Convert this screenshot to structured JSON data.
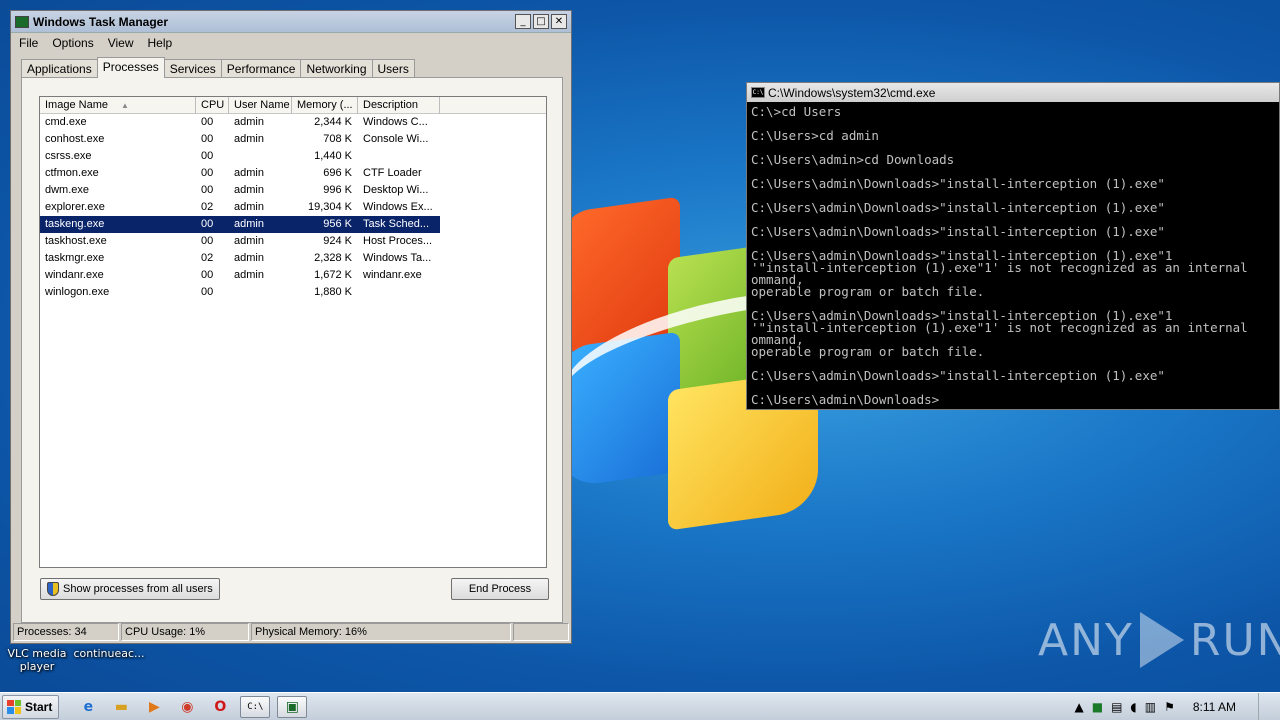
{
  "taskmgr": {
    "title": "Windows Task Manager",
    "menu": [
      "File",
      "Options",
      "View",
      "Help"
    ],
    "tabs": [
      "Applications",
      "Processes",
      "Services",
      "Performance",
      "Networking",
      "Users"
    ],
    "active_tab": "Processes",
    "columns": [
      "Image Name",
      "CPU",
      "User Name",
      "Memory (...",
      "Description"
    ],
    "sort_indicator": "▲",
    "processes": [
      {
        "name": "cmd.exe",
        "cpu": "00",
        "user": "admin",
        "mem": "2,344 K",
        "desc": "Windows C..."
      },
      {
        "name": "conhost.exe",
        "cpu": "00",
        "user": "admin",
        "mem": "708 K",
        "desc": "Console Wi..."
      },
      {
        "name": "csrss.exe",
        "cpu": "00",
        "user": "",
        "mem": "1,440 K",
        "desc": ""
      },
      {
        "name": "ctfmon.exe",
        "cpu": "00",
        "user": "admin",
        "mem": "696 K",
        "desc": "CTF Loader"
      },
      {
        "name": "dwm.exe",
        "cpu": "00",
        "user": "admin",
        "mem": "996 K",
        "desc": "Desktop Wi..."
      },
      {
        "name": "explorer.exe",
        "cpu": "02",
        "user": "admin",
        "mem": "19,304 K",
        "desc": "Windows Ex..."
      },
      {
        "name": "taskeng.exe",
        "cpu": "00",
        "user": "admin",
        "mem": "956 K",
        "desc": "Task Sched...",
        "selected": true
      },
      {
        "name": "taskhost.exe",
        "cpu": "00",
        "user": "admin",
        "mem": "924 K",
        "desc": "Host Proces..."
      },
      {
        "name": "taskmgr.exe",
        "cpu": "02",
        "user": "admin",
        "mem": "2,328 K",
        "desc": "Windows Ta..."
      },
      {
        "name": "windanr.exe",
        "cpu": "00",
        "user": "admin",
        "mem": "1,672 K",
        "desc": "windanr.exe"
      },
      {
        "name": "winlogon.exe",
        "cpu": "00",
        "user": "",
        "mem": "1,880 K",
        "desc": ""
      }
    ],
    "show_all_label": "Show processes from all users",
    "end_process_label": "End Process",
    "status": {
      "processes": "Processes: 34",
      "cpu": "CPU Usage: 1%",
      "memory": "Physical Memory: 16%"
    }
  },
  "cmd": {
    "title": "C:\\Windows\\system32\\cmd.exe",
    "lines": [
      "C:\\>cd Users",
      "",
      "C:\\Users>cd admin",
      "",
      "C:\\Users\\admin>cd Downloads",
      "",
      "C:\\Users\\admin\\Downloads>\"install-interception (1).exe\"",
      "",
      "C:\\Users\\admin\\Downloads>\"install-interception (1).exe\"",
      "",
      "C:\\Users\\admin\\Downloads>\"install-interception (1).exe\"",
      "",
      "C:\\Users\\admin\\Downloads>\"install-interception (1).exe\"1",
      "'\"install-interception (1).exe\"1' is not recognized as an internal",
      "ommand,",
      "operable program or batch file.",
      "",
      "C:\\Users\\admin\\Downloads>\"install-interception (1).exe\"1",
      "'\"install-interception (1).exe\"1' is not recognized as an internal",
      "ommand,",
      "operable program or batch file.",
      "",
      "C:\\Users\\admin\\Downloads>\"install-interception (1).exe\"",
      "",
      "C:\\Users\\admin\\Downloads>"
    ]
  },
  "desktop": {
    "icons": [
      {
        "label": "VLC media player"
      },
      {
        "label": "continueac..."
      }
    ],
    "watermark_left": "ANY",
    "watermark_right": "RUN"
  },
  "taskbar": {
    "start_label": "Start",
    "pinned_icons": [
      "ie-icon",
      "folder-icon",
      "media-player-icon",
      "chrome-icon",
      "opera-icon",
      "cmd-icon",
      "taskmgr-icon"
    ],
    "clock": "8:11 AM"
  }
}
